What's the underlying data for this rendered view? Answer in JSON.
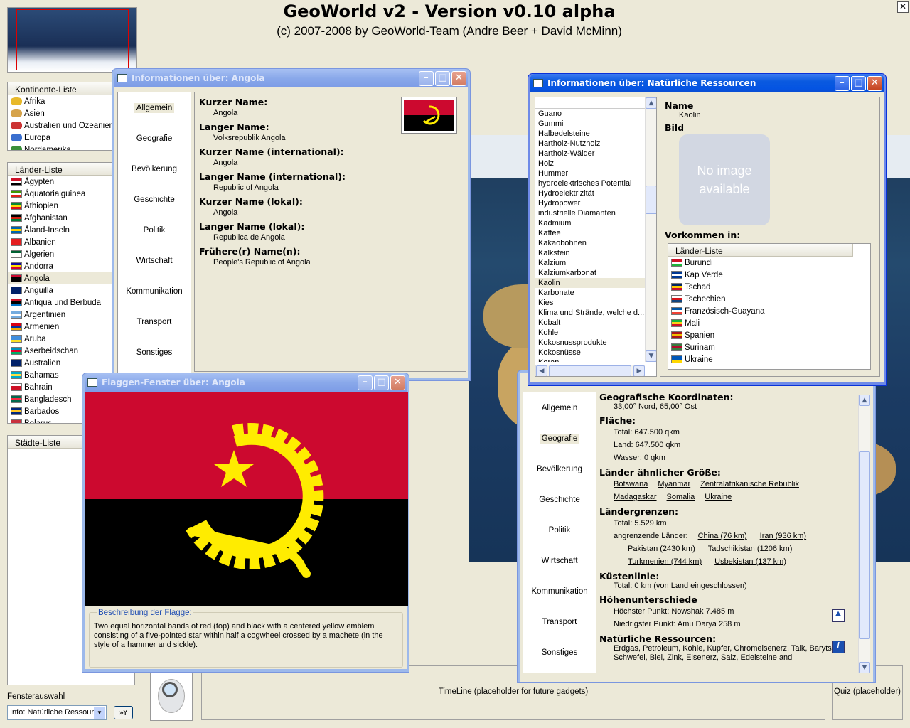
{
  "header": {
    "title": "GeoWorld v2 - Version v0.10 alpha",
    "subtitle": "(c) 2007-2008 by GeoWorld-Team (Andre Beer + David McMinn)",
    "close": "✕"
  },
  "continents": {
    "header": "Kontinente-Liste",
    "items": [
      "Afrika",
      "Asien",
      "Australien und Ozeanien",
      "Europa",
      "Nordamerika"
    ]
  },
  "countries": {
    "header": "Länder-Liste",
    "selected": "Angola",
    "items": [
      {
        "name": "Ägypten",
        "c": [
          "#ce1126",
          "#fff",
          "#000"
        ]
      },
      {
        "name": "Äquatorialguinea",
        "c": [
          "#3e9a00",
          "#fff",
          "#e32118"
        ]
      },
      {
        "name": "Äthiopien",
        "c": [
          "#078930",
          "#fcdd09",
          "#da121a"
        ]
      },
      {
        "name": "Afghanistan",
        "c": [
          "#000",
          "#d32011",
          "#007a36"
        ]
      },
      {
        "name": "Åland-Inseln",
        "c": [
          "#0064ad",
          "#ffd300",
          "#0064ad"
        ]
      },
      {
        "name": "Albanien",
        "c": [
          "#e41e20",
          "#e41e20",
          "#e41e20"
        ]
      },
      {
        "name": "Algerien",
        "c": [
          "#006233",
          "#fff",
          "#fff"
        ]
      },
      {
        "name": "Andorra",
        "c": [
          "#10069f",
          "#fedf00",
          "#d50032"
        ]
      },
      {
        "name": "Angola",
        "c": [
          "#cc092f",
          "#000",
          "#000"
        ]
      },
      {
        "name": "Anguilla",
        "c": [
          "#012169",
          "#012169",
          "#012169"
        ]
      },
      {
        "name": "Antiqua und Berbuda",
        "c": [
          "#ce1126",
          "#000",
          "#0072c6"
        ]
      },
      {
        "name": "Argentinien",
        "c": [
          "#74acdf",
          "#fff",
          "#74acdf"
        ]
      },
      {
        "name": "Armenien",
        "c": [
          "#d90012",
          "#0033a0",
          "#f2a800"
        ]
      },
      {
        "name": "Aruba",
        "c": [
          "#418fde",
          "#418fde",
          "#fbe122"
        ]
      },
      {
        "name": "Aserbeidschan",
        "c": [
          "#0092bc",
          "#e4002b",
          "#00af66"
        ]
      },
      {
        "name": "Australien",
        "c": [
          "#012169",
          "#012169",
          "#012169"
        ]
      },
      {
        "name": "Bahamas",
        "c": [
          "#00abc9",
          "#fae042",
          "#00abc9"
        ]
      },
      {
        "name": "Bahrain",
        "c": [
          "#fff",
          "#ce1126",
          "#ce1126"
        ]
      },
      {
        "name": "Bangladesch",
        "c": [
          "#006a4e",
          "#f42a41",
          "#006a4e"
        ]
      },
      {
        "name": "Barbados",
        "c": [
          "#00267f",
          "#ffc726",
          "#00267f"
        ]
      },
      {
        "name": "Belarus",
        "c": [
          "#c8313e",
          "#c8313e",
          "#4aa657"
        ]
      }
    ]
  },
  "cities": {
    "header": "Städte-Liste"
  },
  "window_select": {
    "label": "Fensterauswahl",
    "value": "Info: Natürliche Ressourc",
    "button": "»Y"
  },
  "timeline": "TimeLine (placeholder for future gadgets)",
  "quiz": "Quiz (placeholder)",
  "win_angola": {
    "title": "Informationen über: Angola",
    "nav": [
      "Allgemein",
      "Geografie",
      "Bevölkerung",
      "Geschichte",
      "Politik",
      "Wirtschaft",
      "Kommunikation",
      "Transport",
      "Sonstiges"
    ],
    "active": "Allgemein",
    "fields": [
      {
        "label": "Kurzer Name:",
        "value": "Angola"
      },
      {
        "label": "Langer Name:",
        "value": "Volksrepublik Angola"
      },
      {
        "label": "Kurzer Name (international):",
        "value": "Angola"
      },
      {
        "label": "Langer Name (international):",
        "value": "Republic of Angola"
      },
      {
        "label": "Kurzer Name (lokal):",
        "value": "Angola"
      },
      {
        "label": "Langer Name (lokal):",
        "value": "Republica de Angola"
      },
      {
        "label": "Frühere(r) Name(n):",
        "value": "People's Republic of Angola"
      }
    ]
  },
  "win_flag": {
    "title": "Flaggen-Fenster über: Angola",
    "desc_label": "Beschreibung der Flagge:",
    "desc": "Two equal horizontal bands of red (top) and black with a centered yellow emblem consisting of a five-pointed star within half a cogwheel crossed by a machete (in the style of a hammer and sickle).",
    "colors": {
      "red": "#cc092f",
      "black": "#000000",
      "yellow": "#ffec00"
    }
  },
  "win_res": {
    "title": "Informationen über: Natürliche Ressourcen",
    "items": [
      "Guano",
      "Gummi",
      "Halbedelsteine",
      "Hartholz-Nutzholz",
      "Hartholz-Wälder",
      "Holz",
      "Hummer",
      "hydroelektrisches Potential",
      "Hydroelektrizität",
      "Hydropower",
      "industrielle Diamanten",
      "Kadmium",
      "Kaffee",
      "Kakaobohnen",
      "Kalkstein",
      "Kalzium",
      "Kalziumkarbonat",
      "Kaolin",
      "Karbonate",
      "Kies",
      "Klima und Strände, welche d...",
      "Kobalt",
      "Kohle",
      "Kokosnussprodukte",
      "Kokosnüsse",
      "Koran"
    ],
    "selected": "Kaolin",
    "name_label": "Name",
    "name": "Kaolin",
    "image_label": "Bild",
    "no_image": "No image available",
    "occurs_label": "Vorkommen in:",
    "occurs_header": "Länder-Liste",
    "occurs": [
      {
        "name": "Burundi",
        "c": [
          "#ce1126",
          "#fff",
          "#1eb53a"
        ]
      },
      {
        "name": "Kap Verde",
        "c": [
          "#003893",
          "#fff",
          "#003893"
        ]
      },
      {
        "name": "Tschad",
        "c": [
          "#002664",
          "#fecb00",
          "#c60c30"
        ]
      },
      {
        "name": "Tschechien",
        "c": [
          "#fff",
          "#d7141a",
          "#11457e"
        ]
      },
      {
        "name": "Französisch-Guayana",
        "c": [
          "#0055a4",
          "#fff",
          "#ef4135"
        ]
      },
      {
        "name": "Mali",
        "c": [
          "#14b53a",
          "#fcd116",
          "#ce1126"
        ]
      },
      {
        "name": "Spanien",
        "c": [
          "#aa151b",
          "#f1bf00",
          "#aa151b"
        ]
      },
      {
        "name": "Surinam",
        "c": [
          "#377e3f",
          "#b40a2d",
          "#377e3f"
        ]
      },
      {
        "name": "Ukraine",
        "c": [
          "#0057b7",
          "#0057b7",
          "#ffd700"
        ]
      }
    ]
  },
  "win_geo": {
    "nav": [
      "Allgemein",
      "Geografie",
      "Bevölkerung",
      "Geschichte",
      "Politik",
      "Wirtschaft",
      "Kommunikation",
      "Transport",
      "Sonstiges"
    ],
    "active": "Geografie",
    "coords_h": "Geografische Koordinaten:",
    "coords": "33,00° Nord, 65,00° Ost",
    "area_h": "Fläche:",
    "area_total": "Total:  647.500 qkm",
    "area_land": "Land:  647.500 qkm",
    "area_water": "Wasser:  0 qkm",
    "similar_h": "Länder ähnlicher Größe:",
    "similar": [
      "Botswana",
      "Myanmar",
      "Zentralafrikanische Rebublik",
      "Madagaskar",
      "Somalia",
      "Ukraine"
    ],
    "borders_h": "Ländergrenzen:",
    "borders_total": "Total:  5.529 km",
    "neighbors_label": "angrenzende Länder:",
    "neighbors": [
      "China (76 km)",
      "Iran (936 km)",
      "Pakistan (2430 km)",
      "Tadschikistan (1206 km)",
      "Turkmenien (744 km)",
      "Usbekistan (137 km)"
    ],
    "coast_h": "Küstenlinie:",
    "coast": "Total:  0 km  (von Land eingeschlossen)",
    "elev_h": "Höhenunterschiede",
    "elev_high": "Höchster Punkt: Nowshak  7.485 m",
    "elev_low": "Niedrigster Punkt: Amu Darya  258 m",
    "res_h": "Natürliche Ressourcen:",
    "res": "Erdgas, Petroleum, Kohle, Kupfer, Chromeisenerz, Talk, Baryts, Schwefel, Blei, Zink, Eisenerz, Salz, Edelsteine and"
  }
}
